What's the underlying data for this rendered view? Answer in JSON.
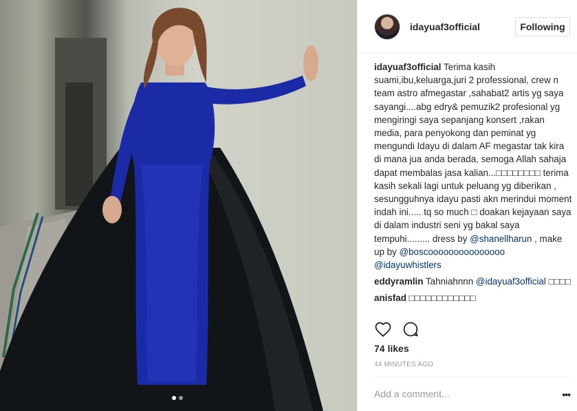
{
  "post": {
    "username": "idayuaf3official",
    "follow_label": "Following",
    "likes": "74 likes",
    "time": "44 MINUTES AGO",
    "add_comment_placeholder": "Add a comment...",
    "more": "•••",
    "carousel": {
      "count": 2,
      "active": 1
    }
  },
  "caption": {
    "user": "idayuaf3official",
    "text": "Terima kasih suami,ibu,keluarga,juri 2 professional, crew n team astro afmegastar ,sahabat2 artis yg saya sayangi....abg edry& pemuzik2 profesional yg mengiringi saya sepanjang konsert ,rakan media, para penyokong dan peminat yg mengundi Idayu di dalam AF megastar tak kira di mana jua anda berada, semoga Allah sahaja dapat membalas jasa kalian...□□□□□□□□ terima kasih sekali lagi untuk peluang yg diberikan , sesungguhnya idayu pasti akn merindui moment indah ini..... tq so much □ doakan kejayaan saya di dalam industri seni yg bakal saya tempuhi......... dress by ",
    "mention1": "@shanellharun",
    "mid": " , make up by ",
    "mention2": "@boscooooooooooooooo",
    "space": " ",
    "mention3": "@idayuwhistlers"
  },
  "comments": [
    {
      "user": "eddyramlin",
      "text": "Tahniahnnn ",
      "mention": "@idayuaf3official",
      "tail": " □□□□"
    },
    {
      "user": "anisfad",
      "text": "□□□□□□□□□□□□"
    }
  ],
  "icons": {
    "like": "heart-icon",
    "comment": "comment-bubble-icon"
  }
}
